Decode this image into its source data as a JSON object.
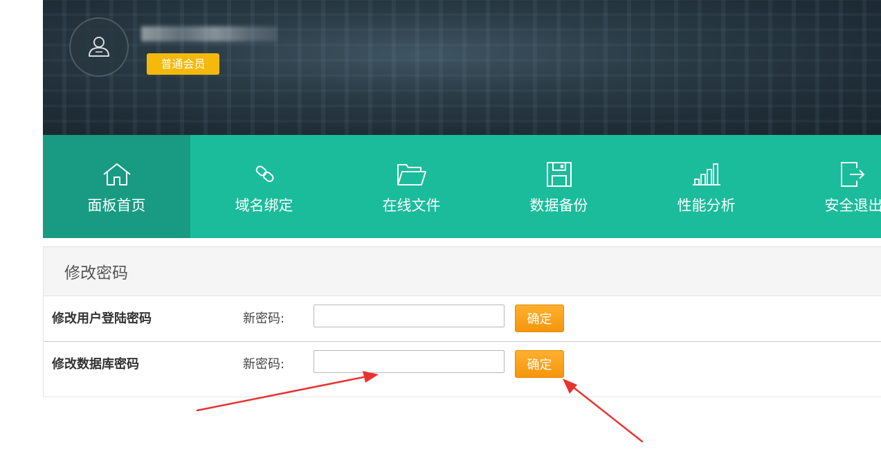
{
  "header": {
    "avatar_icon": "user-icon",
    "member_badge": "普通会员"
  },
  "nav": {
    "items": [
      {
        "label": "面板首页",
        "icon": "home-icon",
        "active": true
      },
      {
        "label": "域名绑定",
        "icon": "link-icon",
        "active": false
      },
      {
        "label": "在线文件",
        "icon": "folder-icon",
        "active": false
      },
      {
        "label": "数据备份",
        "icon": "save-icon",
        "active": false
      },
      {
        "label": "性能分析",
        "icon": "bar-chart-icon",
        "active": false
      },
      {
        "label": "安全退出",
        "icon": "logout-icon",
        "active": false
      }
    ]
  },
  "panel": {
    "title": "修改密码",
    "rows": [
      {
        "title": "修改用户登陆密码",
        "field_label": "新密码:",
        "value": "",
        "button_label": "确定"
      },
      {
        "title": "修改数据库密码",
        "field_label": "新密码:",
        "value": "",
        "button_label": "确定"
      }
    ]
  },
  "colors": {
    "nav_bg": "#1bbc9b",
    "nav_active_bg": "#189b82",
    "badge_bg": "#f5b90c",
    "button_bg": "#f6950c",
    "annotation_arrow": "#e8322f"
  }
}
